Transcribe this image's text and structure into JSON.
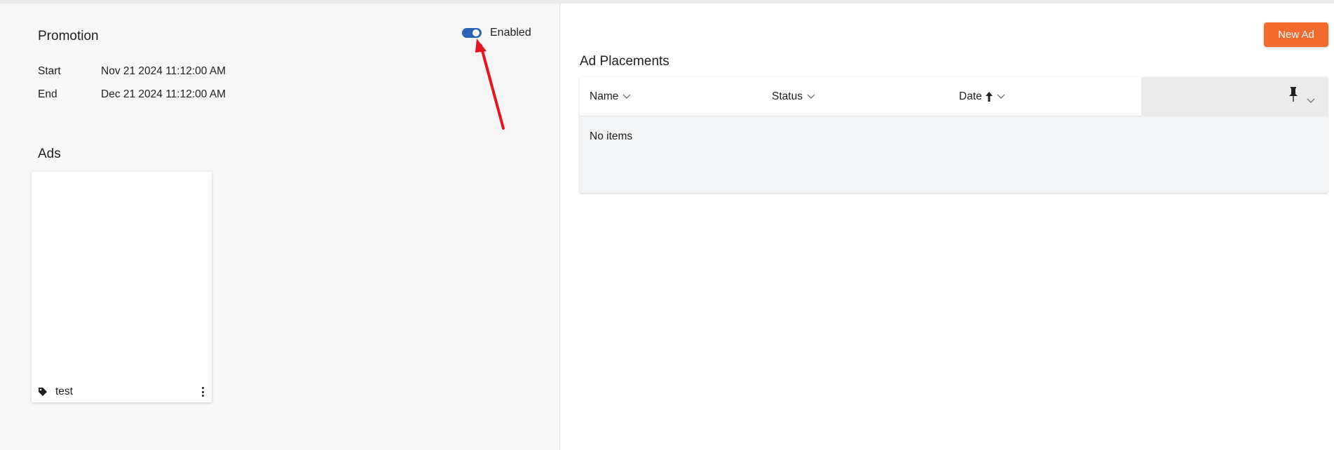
{
  "promotion": {
    "title": "Promotion",
    "toggle_label": "Enabled",
    "toggle_on": true,
    "start_label": "Start",
    "start_value": "Nov 21 2024 11:12:00 AM",
    "end_label": "End",
    "end_value": "Dec 21 2024 11:12:00 AM"
  },
  "ads": {
    "title": "Ads",
    "cards": [
      {
        "name": "test",
        "icon": "tag-icon"
      }
    ]
  },
  "placements": {
    "new_ad_label": "New Ad",
    "title": "Ad Placements",
    "columns": [
      {
        "label": "Name"
      },
      {
        "label": "Status"
      },
      {
        "label": "Date",
        "sort": "ascending"
      }
    ],
    "empty_text": "No items"
  },
  "colors": {
    "accent": "#f26a2e",
    "toggle": "#2b63b5",
    "annotation_arrow": "#e8141b"
  }
}
